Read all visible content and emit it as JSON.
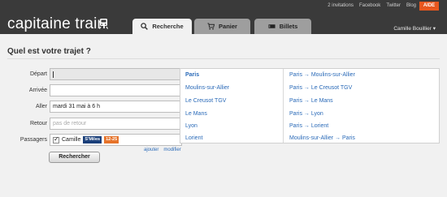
{
  "header": {
    "logo": "capitaine train",
    "links": [
      "2 invitations",
      "Facebook",
      "Twitter",
      "Blog"
    ],
    "help": "AIDE",
    "user": "Camille Bouillier ▾",
    "tabs": [
      {
        "label": "Recherche",
        "icon": "search-icon",
        "active": true
      },
      {
        "label": "Panier",
        "icon": "cart-icon",
        "active": false
      },
      {
        "label": "Billets",
        "icon": "ticket-icon",
        "active": false
      }
    ]
  },
  "main": {
    "title": "Quel est votre trajet ?",
    "form": {
      "depart_label": "Départ",
      "depart_value": "",
      "arrivee_label": "Arrivée",
      "arrivee_value": "",
      "aller_label": "Aller",
      "aller_value": "mardi 31 mai à 6 h",
      "retour_label": "Retour",
      "retour_placeholder": "pas de retour",
      "passagers_label": "Passagers",
      "passenger_name": "Camille",
      "passenger_card": "S'Miles",
      "passenger_age": "12-25",
      "add_link": "ajouter",
      "edit_link": "modifier",
      "search_button": "Rechercher"
    },
    "suggestions": {
      "left": [
        "Paris",
        "Moulins-sur-Allier",
        "Le Creusot TGV",
        "Le Mans",
        "Lyon",
        "Lorient"
      ],
      "right": [
        "Paris → Moulins-sur-Allier",
        "Paris → Le Creusot TGV",
        "Paris → Le Mans",
        "Paris → Lyon",
        "Paris → Lorient",
        "Moulins-sur-Allier → Paris"
      ]
    }
  }
}
